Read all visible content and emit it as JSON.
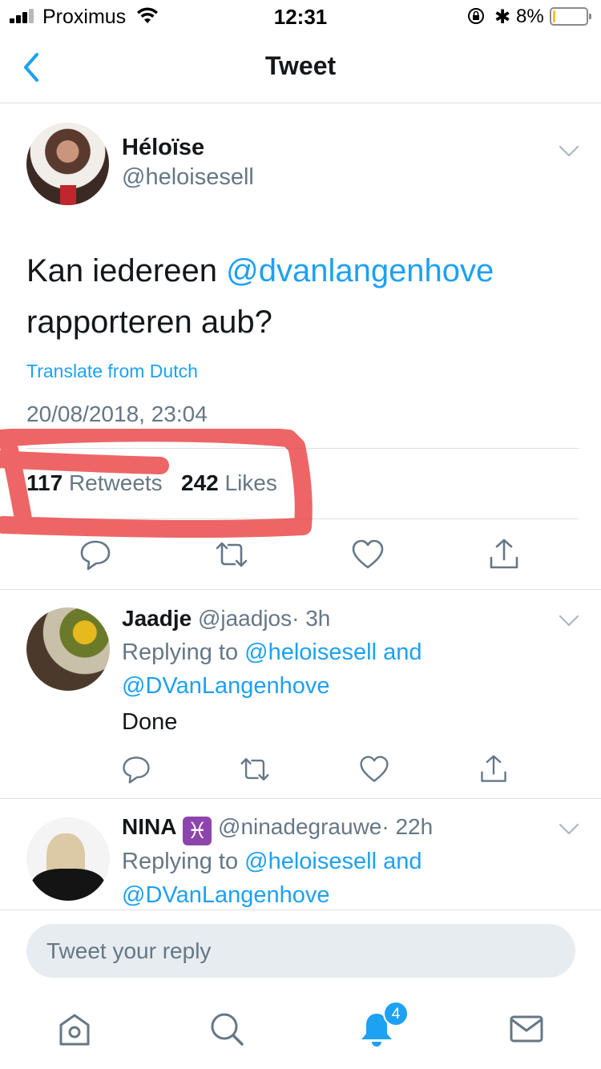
{
  "status_bar": {
    "carrier": "Proximus",
    "time": "12:31",
    "battery_percent": "8%",
    "battery_level": 0.08
  },
  "nav": {
    "title": "Tweet"
  },
  "tweet": {
    "author_name": "Héloïse",
    "author_handle": "@heloisesell",
    "text_before": "Kan iedereen ",
    "mention": "@dvanlangenhove",
    "text_after": " rapporteren aub?",
    "translate_label": "Translate from Dutch",
    "timestamp": "20/08/2018, 23:04",
    "retweet_count": "117",
    "retweet_label": "Retweets",
    "like_count": "242",
    "like_label": "Likes"
  },
  "replies": [
    {
      "name": "Jaadje",
      "handle": "@jaadjos",
      "time": "· 3h",
      "replying_prefix": "Replying to",
      "replying_to": "@heloisesell and",
      "replying_to_2": "@DVanLangenhove",
      "body": "Done"
    },
    {
      "name": "NINA",
      "emoji": "♓",
      "handle": "@ninadegrauwe",
      "time": "· 22h",
      "replying_prefix": "Replying to",
      "replying_to": "@heloisesell and",
      "replying_to_2": "@DVanLangenhove"
    }
  ],
  "composer": {
    "placeholder": "Tweet your reply"
  },
  "tab_bar": {
    "notification_count": "4",
    "icons": [
      "home-icon",
      "search-icon",
      "notifications-icon",
      "messages-icon"
    ]
  },
  "colors": {
    "link": "#1da1f2",
    "secondary_text": "#657786",
    "annotation_red": "#e8403f"
  }
}
